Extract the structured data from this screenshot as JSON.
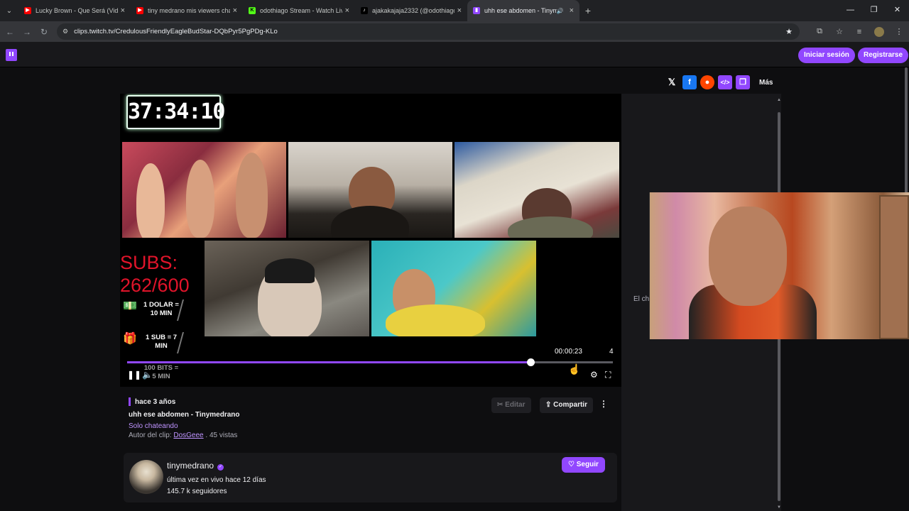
{
  "browser": {
    "tabs": [
      {
        "title": "Lucky Brown - Que Será (Video",
        "favicon_color": "#ff0000",
        "favicon": "▶"
      },
      {
        "title": "tiny medrano mis viewers cham",
        "favicon_color": "#ff0000",
        "favicon": "▶"
      },
      {
        "title": "odothiago Stream - Watch Live",
        "favicon_color": "#53fc18",
        "favicon": "K"
      },
      {
        "title": "ajakakajaja2332 (@odothiago)",
        "favicon_color": "#000000",
        "favicon": "♪"
      },
      {
        "title": "uhh ese abdomen - Tinyme",
        "favicon_color": "#9147ff",
        "favicon": "▮",
        "active": true
      }
    ],
    "url": "clips.twitch.tv/CredulousFriendlyEagleBudStar-DQbPyr5PgPDg-KLo"
  },
  "twitch_header": {
    "login_label": "Iniciar sesión",
    "register_label": "Registrarse"
  },
  "share": {
    "x_icon": "𝕏",
    "facebook_icon": "f",
    "reddit_icon": "●",
    "embed_icon": "</>",
    "copy_icon": "❐",
    "more_label": "Más"
  },
  "stream_overlay": {
    "timer": "37:34:10",
    "subs_label": "SUBS:",
    "subs_count": "262/600",
    "promo1": "1 DOLAR = 10 MIN",
    "promo2": "1 SUB = 7 MIN",
    "promo3": "100 BITS = 5 MIN"
  },
  "player": {
    "current_time": "00:00:23",
    "right_number": "4",
    "progress": 0.83
  },
  "chat": {
    "partial_text": "El cha"
  },
  "clip": {
    "when": "hace 3 años",
    "title": "uhh ese abdomen - Tinymedrano",
    "category": "Solo chateando",
    "author_prefix": "Autor del clip:",
    "author": "DosGeee",
    "views": ". 45 vistas",
    "edit_label": "Editar",
    "share_label": "Compartir"
  },
  "channel": {
    "name": "tinymedrano",
    "last_live": "última vez en vivo hace 12 días",
    "followers": "145.7 k seguidores",
    "follow_label": "Seguir"
  },
  "colors": {
    "accent": "#9147ff",
    "link": "#bf94ff",
    "subs_red": "#e0142a"
  }
}
